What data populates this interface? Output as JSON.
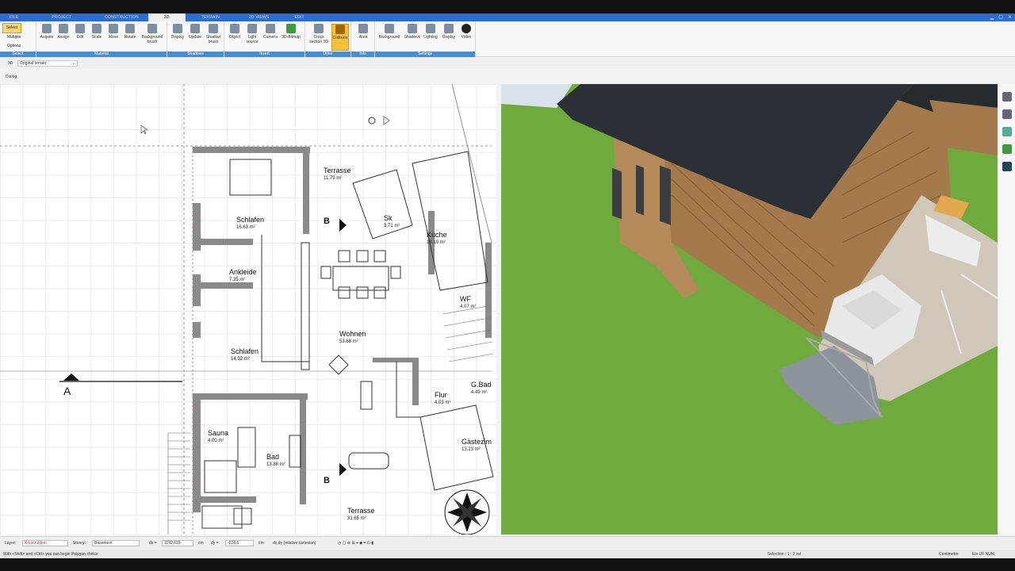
{
  "menu_tabs": [
    "FILE",
    "PROJECT",
    "CONSTRUCTION",
    "3D",
    "TERRAIN",
    "2D VIEWS",
    "EDIT"
  ],
  "active_tab": "3D",
  "select_panel": {
    "select": "Select",
    "multiple": "Multiple",
    "options": "Options",
    "group": "Select"
  },
  "ribbon_groups": [
    {
      "label": "Material",
      "tools": [
        "Acquire",
        "Assign",
        "Edit",
        "Scale",
        "Move",
        "Rotate",
        "Background brush"
      ]
    },
    {
      "label": "Shadows",
      "tools": [
        "Display",
        "Update",
        "Shadow brush"
      ]
    },
    {
      "label": "Insert",
      "tools": [
        "Object",
        "Light source",
        "Camera",
        "3D-Bitmap"
      ]
    },
    {
      "label": "Other",
      "tools": [
        "Cross section 3D",
        "Collision"
      ]
    },
    {
      "label": "Info",
      "tools": [
        "Area"
      ]
    },
    {
      "label": "Settings",
      "tools": [
        "Background",
        "Shadows",
        "Lighting",
        "Display",
        "Video"
      ]
    }
  ],
  "subbar": {
    "mode": "3D",
    "terrain": "Original terrain"
  },
  "dialog_label": "Dialog",
  "rooms": [
    {
      "name": "Terrasse",
      "area": "11.79 m²"
    },
    {
      "name": "Schlafen",
      "area": "16.63 m²"
    },
    {
      "name": "Sk",
      "area": "3.71 m²"
    },
    {
      "name": "Küche",
      "area": "13.10 m²"
    },
    {
      "name": "Ankleide",
      "area": "7.35 m²"
    },
    {
      "name": "WF",
      "area": "4.07 m²"
    },
    {
      "name": "Wohnen",
      "area": "53.68 m²"
    },
    {
      "name": "Schlafen",
      "area": "14.92 m²"
    },
    {
      "name": "G.Bad",
      "area": "4.49 m²"
    },
    {
      "name": "Flur",
      "area": "4.03 m²"
    },
    {
      "name": "Sauna",
      "area": "4.00 m²"
    },
    {
      "name": "Bad",
      "area": "13.88 m²"
    },
    {
      "name": "Gästezim",
      "area": "13.23 m²"
    },
    {
      "name": "Terrasse",
      "area": "31.65 m²"
    }
  ],
  "section_marks": {
    "a": "A",
    "b": "B"
  },
  "status": {
    "layer_label": "Layer:",
    "layer_value": "Konstruktion",
    "storey_label": "Storey:",
    "storey_value": "Basement",
    "dx_label": "dx =",
    "dx_value": "1192.615",
    "dx_unit": "cm",
    "dy_label": "dy =",
    "dy_value": "-678.6",
    "dy_unit": "cm",
    "coord_mode": "dx,dy (relative cartesian)"
  },
  "hint": {
    "text": "With <Shift> and <Ctrl> you can begin Polygon choice",
    "selection": "Selection : 1 : 2 sel",
    "unit": "Centimetre",
    "flags": "Ein  UF  NUM"
  },
  "colors": {
    "accent": "#2b6cd6",
    "group_bar": "#3f8fe0",
    "highlight": "#f3c13a",
    "grass": "#6eaa3c",
    "roof": "#2a3035",
    "wood": "#a47a4c"
  }
}
